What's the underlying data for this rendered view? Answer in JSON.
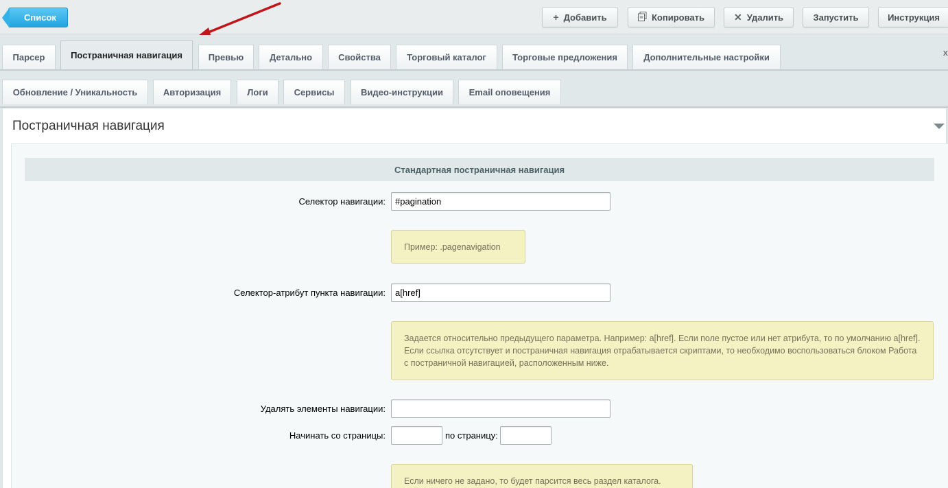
{
  "toolbar": {
    "list_label": "Список",
    "add_label": "Добавить",
    "copy_label": "Копировать",
    "delete_label": "Удалить",
    "run_label": "Запустить",
    "instruction_label": "Инструкция"
  },
  "tabs_row1": [
    "Парсер",
    "Постраничная навигация",
    "Превью",
    "Детально",
    "Свойства",
    "Торговый каталог",
    "Торговые предложения",
    "Дополнительные настройки"
  ],
  "tabs_row2": [
    "Обновление / Уникальность",
    "Авторизация",
    "Логи",
    "Сервисы",
    "Видео-инструкции",
    "Email оповещения"
  ],
  "active_tab": "Постраничная навигация",
  "panel": {
    "title": "Постраничная навигация",
    "section_title": "Стандартная постраничная навигация"
  },
  "form": {
    "nav_selector_label": "Селектор навигации:",
    "nav_selector_value": "#pagination",
    "nav_selector_hint": "Пример: .pagenavigation",
    "nav_attr_label": "Селектор-атрибут пункта навигации:",
    "nav_attr_value": "a[href]",
    "nav_attr_hint": "Задается относительно предыдущего параметра. Например: a[href]. Если поле пустое или нет атрибута, то по умолчанию a[href]. Если ссылка отсутствует и постраничная навигация отрабатывается скриптами, то необходимо воспользоваться блоком Работа с постраничной навигацией, расположенным ниже.",
    "remove_nav_label": "Удалять элементы навигации:",
    "remove_nav_value": "",
    "start_page_label": "Начинать со страницы:",
    "start_page_value": "",
    "to_page_label": "по страницу:",
    "to_page_value": "",
    "range_hint": "Если ничего не задано, то будет парсится весь раздел каталога."
  },
  "colors": {
    "accent": "#21a4e0",
    "annotation_arrow": "#c0161b",
    "hint_background": "#f4f1c2"
  }
}
